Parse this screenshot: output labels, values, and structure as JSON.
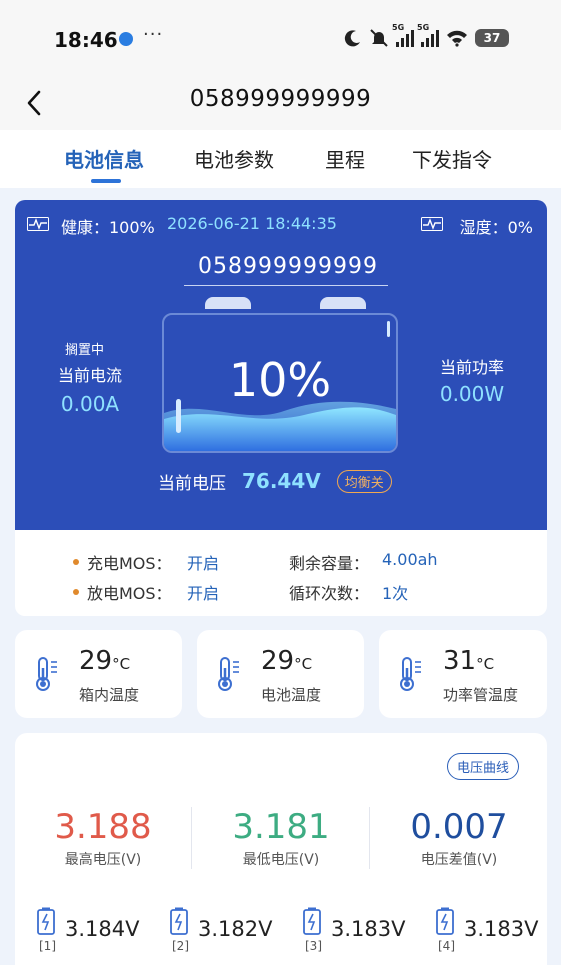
{
  "status_bar": {
    "time": "18:46",
    "more": "···",
    "battery": "37",
    "net1": "5G",
    "net2": "5G"
  },
  "header": {
    "title": "058999999999"
  },
  "tabs": [
    {
      "label": "电池信息",
      "active": true
    },
    {
      "label": "电池参数",
      "active": false
    },
    {
      "label": "里程",
      "active": false
    },
    {
      "label": "下发指令",
      "active": false
    }
  ],
  "battery_card": {
    "health_label": "健康：100%",
    "timestamp": "2026-06-21 18:44:35",
    "humidity_label": "湿度：0%",
    "device_id": "058999999999",
    "percent": "10%",
    "level": 0.1,
    "state": "搁置中",
    "current_label": "当前电流",
    "current_value": "0.00A",
    "power_label": "当前功率",
    "power_value": "0.00W",
    "voltage_label": "当前电压",
    "voltage_value": "76.44V",
    "balance_badge": "均衡关"
  },
  "mos": {
    "charge_label": "充电MOS：",
    "charge_value": "开启",
    "discharge_label": "放电MOS：",
    "discharge_value": "开启",
    "remaining_label": "剩余容量：",
    "remaining_value": "4.00ah",
    "cycles_label": "循环次数：",
    "cycles_value": "1次"
  },
  "temperatures": [
    {
      "value": "29",
      "unit": "°C",
      "label": "箱内温度"
    },
    {
      "value": "29",
      "unit": "°C",
      "label": "电池温度"
    },
    {
      "value": "31",
      "unit": "°C",
      "label": "功率管温度"
    }
  ],
  "voltage_stats": {
    "curve_button": "电压曲线",
    "max_value": "3.188",
    "max_label": "最高电压(V)",
    "min_value": "3.181",
    "min_label": "最低电压(V)",
    "diff_value": "0.007",
    "diff_label": "电压差值(V)",
    "colors": {
      "max": "#e05a4a",
      "min": "#3dac82",
      "diff": "#1f4e9e"
    }
  },
  "cells": [
    {
      "value": "3.184V",
      "index": "[1]"
    },
    {
      "value": "3.182V",
      "index": "[2]"
    },
    {
      "value": "3.183V",
      "index": "[3]"
    },
    {
      "value": "3.183V",
      "index": "[4]"
    }
  ],
  "colors": {
    "primary": "#2c4eb8",
    "accent_text": "#8fe1ff",
    "tab_active": "#2563b8",
    "mos_dot": "#e0892c"
  }
}
